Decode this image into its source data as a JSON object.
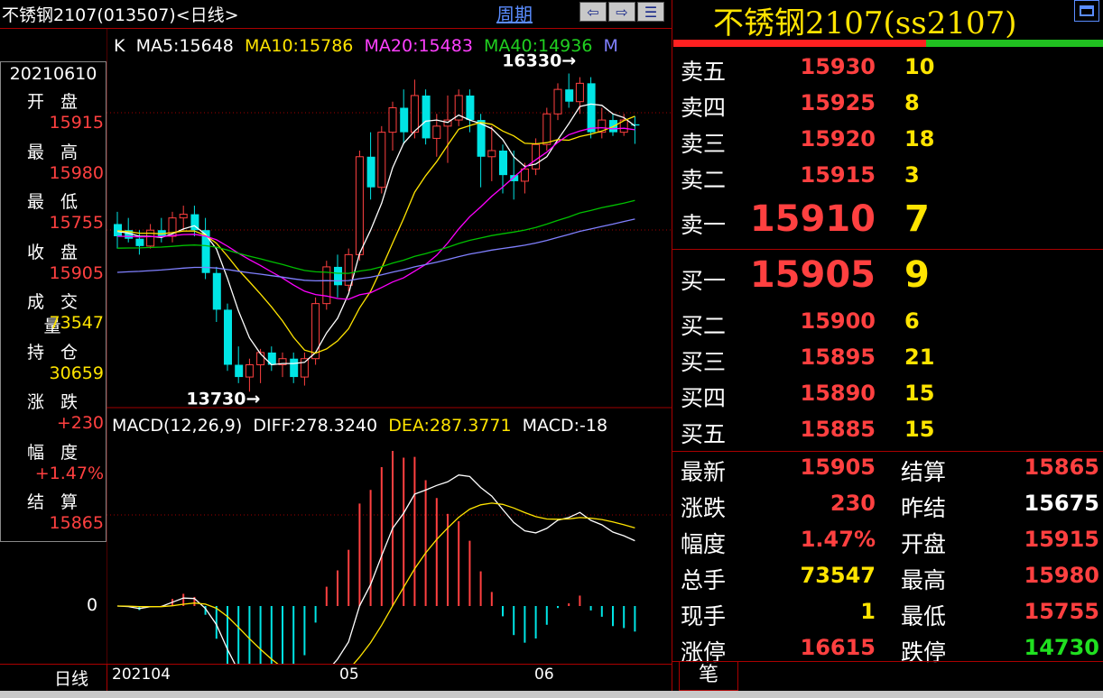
{
  "header": {
    "title": "不锈钢2107(013507)<日线>",
    "period_link": "周期",
    "nav_buttons": [
      "⇦",
      "⇨",
      "☰"
    ]
  },
  "info_panel": {
    "date": "20210610",
    "items": [
      {
        "label": "开盘",
        "value": "15915"
      },
      {
        "label": "最高",
        "value": "15980"
      },
      {
        "label": "最低",
        "value": "15755"
      },
      {
        "label": "收盘",
        "value": "15905"
      },
      {
        "label": "成交量",
        "value": "73547"
      },
      {
        "label": "持仓",
        "value": "30659"
      },
      {
        "label": "涨跌",
        "value": "+230"
      },
      {
        "label": "幅度",
        "value": "+1.47%"
      },
      {
        "label": "结算",
        "value": "15865"
      }
    ]
  },
  "ma_header": {
    "k": "K",
    "ma5": "MA5:15648",
    "ma10": "MA10:15786",
    "ma20": "MA20:15483",
    "ma40": "MA40:14936",
    "tail": "M"
  },
  "annotations": {
    "high": "16330",
    "low": "13730"
  },
  "macd_header": {
    "name": "MACD(12,26,9)",
    "diff": "DIFF:278.3240",
    "dea": "DEA:287.3771",
    "macd": "MACD:-18"
  },
  "macd_zero_label": "0",
  "bottom_axis": {
    "period": "日线",
    "dates": [
      "202104",
      "05",
      "06"
    ]
  },
  "right_panel": {
    "title": "不锈钢2107(ss2107)",
    "asks": [
      {
        "label": "卖五",
        "price": "15930",
        "qty": "10"
      },
      {
        "label": "卖四",
        "price": "15925",
        "qty": "8"
      },
      {
        "label": "卖三",
        "price": "15920",
        "qty": "18"
      },
      {
        "label": "卖二",
        "price": "15915",
        "qty": "3"
      },
      {
        "label": "卖一",
        "price": "15910",
        "qty": "7"
      }
    ],
    "bids": [
      {
        "label": "买一",
        "price": "15905",
        "qty": "9"
      },
      {
        "label": "买二",
        "price": "15900",
        "qty": "6"
      },
      {
        "label": "买三",
        "price": "15895",
        "qty": "21"
      },
      {
        "label": "买四",
        "price": "15890",
        "qty": "15"
      },
      {
        "label": "买五",
        "price": "15885",
        "qty": "15"
      }
    ],
    "stats": [
      {
        "l1": "最新",
        "v1": "15905",
        "c1": "#ff4040",
        "l2": "结算",
        "v2": "15865",
        "c2": "#ff4040"
      },
      {
        "l1": "涨跌",
        "v1": "230",
        "c1": "#ff4040",
        "l2": "昨结",
        "v2": "15675",
        "c2": "#ffffff"
      },
      {
        "l1": "幅度",
        "v1": "1.47%",
        "c1": "#ff4040",
        "l2": "开盘",
        "v2": "15915",
        "c2": "#ff4040"
      },
      {
        "l1": "总手",
        "v1": "73547",
        "c1": "#ffe400",
        "l2": "最高",
        "v2": "15980",
        "c2": "#ff4040"
      },
      {
        "l1": "现手",
        "v1": "1",
        "c1": "#ffe400",
        "l2": "最低",
        "v2": "15755",
        "c2": "#ff4040"
      },
      {
        "l1": "涨停",
        "v1": "16615",
        "c1": "#ff4040",
        "l2": "跌停",
        "v2": "14730",
        "c2": "#20e020"
      }
    ],
    "tab": "笔"
  },
  "colors": {
    "up": "#ff4040",
    "down": "#00e5e5",
    "ma5": "#ffffff",
    "ma10": "#ffe400",
    "ma20": "#ff00ff",
    "ma40": "#00c000",
    "ma60": "#8080ff",
    "diff": "#ffffff",
    "dea": "#ffe400",
    "grid": "#a00000"
  },
  "chart_data": [
    {
      "type": "candlestick",
      "title": "不锈钢2107(013507)<日线>",
      "x_labels": [
        "202104",
        "05",
        "06"
      ],
      "ylim": [
        13600,
        16400
      ],
      "candles": [
        [
          15100,
          15200,
          14900,
          15000
        ],
        [
          15050,
          15150,
          14950,
          14980
        ],
        [
          14980,
          15050,
          14850,
          14920
        ],
        [
          14920,
          15100,
          14900,
          15050
        ],
        [
          15050,
          15150,
          14950,
          15000
        ],
        [
          15000,
          15200,
          14950,
          15150
        ],
        [
          15150,
          15250,
          15050,
          15180
        ],
        [
          15180,
          15250,
          15000,
          15050
        ],
        [
          15050,
          15150,
          14650,
          14700
        ],
        [
          14700,
          14750,
          14300,
          14400
        ],
        [
          14400,
          14450,
          13900,
          13950
        ],
        [
          13950,
          14100,
          13800,
          13850
        ],
        [
          13850,
          14000,
          13730,
          13950
        ],
        [
          13950,
          14080,
          13800,
          14050
        ],
        [
          14050,
          14100,
          13900,
          13950
        ],
        [
          13950,
          14050,
          13850,
          14000
        ],
        [
          14000,
          14050,
          13800,
          13850
        ],
        [
          13850,
          14050,
          13780,
          14000
        ],
        [
          14000,
          14500,
          13950,
          14450
        ],
        [
          14450,
          14800,
          14400,
          14750
        ],
        [
          14750,
          14850,
          14500,
          14600
        ],
        [
          14600,
          14900,
          14550,
          14850
        ],
        [
          14850,
          15700,
          14800,
          15650
        ],
        [
          15650,
          15850,
          15300,
          15400
        ],
        [
          15400,
          15900,
          15350,
          15850
        ],
        [
          15850,
          16100,
          15700,
          16050
        ],
        [
          16050,
          16200,
          15750,
          15850
        ],
        [
          15850,
          16280,
          15800,
          16150
        ],
        [
          16150,
          16200,
          15750,
          15800
        ],
        [
          15800,
          16000,
          15650,
          15900
        ],
        [
          15900,
          16150,
          15600,
          15950
        ],
        [
          15950,
          16200,
          15900,
          16150
        ],
        [
          16150,
          16200,
          15850,
          15950
        ],
        [
          15950,
          16000,
          15400,
          15650
        ],
        [
          15650,
          15900,
          15450,
          15700
        ],
        [
          15700,
          15750,
          15350,
          15500
        ],
        [
          15500,
          15700,
          15300,
          15450
        ],
        [
          15450,
          15600,
          15350,
          15550
        ],
        [
          15550,
          15800,
          15500,
          15750
        ],
        [
          15750,
          16050,
          15700,
          16000
        ],
        [
          16000,
          16250,
          15950,
          16200
        ],
        [
          16200,
          16330,
          16050,
          16100
        ],
        [
          16100,
          16300,
          16000,
          16250
        ],
        [
          16250,
          16300,
          15800,
          15850
        ],
        [
          15850,
          16050,
          15800,
          15950
        ],
        [
          15950,
          16000,
          15820,
          15850
        ],
        [
          15850,
          16000,
          15820,
          15950
        ],
        [
          15915,
          15980,
          15755,
          15905
        ]
      ],
      "ma_legend": {
        "MA5": 15648,
        "MA10": 15786,
        "MA20": 15483,
        "MA40": 14936
      },
      "annotations": [
        {
          "text": "16330",
          "kind": "high"
        },
        {
          "text": "13730",
          "kind": "low"
        }
      ]
    },
    {
      "type": "bar+line",
      "title": "MACD(12,26,9)",
      "series": [
        {
          "name": "DIFF",
          "last": 278.324
        },
        {
          "name": "DEA",
          "last": 287.3771
        }
      ],
      "macd_last": -18
    }
  ]
}
